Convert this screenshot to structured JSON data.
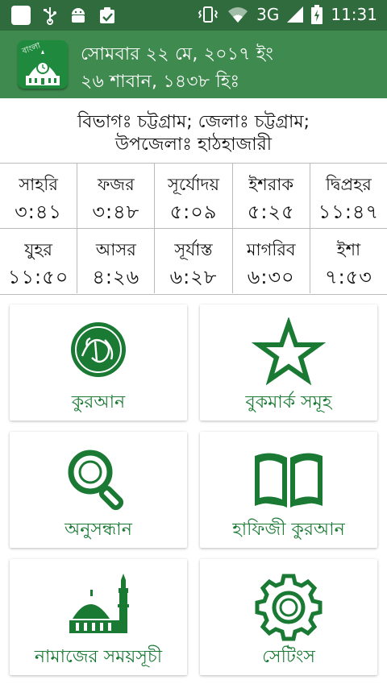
{
  "status_bar": {
    "network": "3G",
    "time": "11:31"
  },
  "header": {
    "logo_text": "বাংলা",
    "gregorian_date": "সোমবার ২২ মে, ২০১৭ ইং",
    "hijri_date": "২৬ শাবান, ১৪৩৮ হিঃ"
  },
  "location": {
    "line1": "বিভাগঃ চট্টগ্রাম; জেলাঃ চট্টগ্রাম;",
    "line2": "উপজেলাঃ হাঠহাজারী"
  },
  "prayer_times": [
    {
      "name": "সাহরি",
      "time": "৩:৪১"
    },
    {
      "name": "ফজর",
      "time": "৩:৪৮"
    },
    {
      "name": "সূর্যোদয়",
      "time": "৫:০৯"
    },
    {
      "name": "ইশরাক",
      "time": "৫:২৫"
    },
    {
      "name": "দ্বিপ্রহর",
      "time": "১১:৪৭"
    },
    {
      "name": "যুহর",
      "time": "১১:৫০"
    },
    {
      "name": "আসর",
      "time": "৪:২৬"
    },
    {
      "name": "সূর্যাস্ত",
      "time": "৬:২৮"
    },
    {
      "name": "মাগরিব",
      "time": "৬:৩০"
    },
    {
      "name": "ইশা",
      "time": "৭:৫৩"
    }
  ],
  "menu": [
    {
      "label": "কুরআন",
      "icon": "quran-icon"
    },
    {
      "label": "বুকমার্ক সমূহ",
      "icon": "star-icon"
    },
    {
      "label": "অনুসন্ধান",
      "icon": "magnifier-icon"
    },
    {
      "label": "হাফিজী কুরআন",
      "icon": "open-book-icon"
    },
    {
      "label": "নামাজের সময়সূচী",
      "icon": "mosque-icon"
    },
    {
      "label": "সেটিংস",
      "icon": "gear-icon"
    }
  ],
  "colors": {
    "status_bar": "#2f6b3d",
    "app_bar": "#3f8a4f",
    "accent": "#1a7a34"
  }
}
